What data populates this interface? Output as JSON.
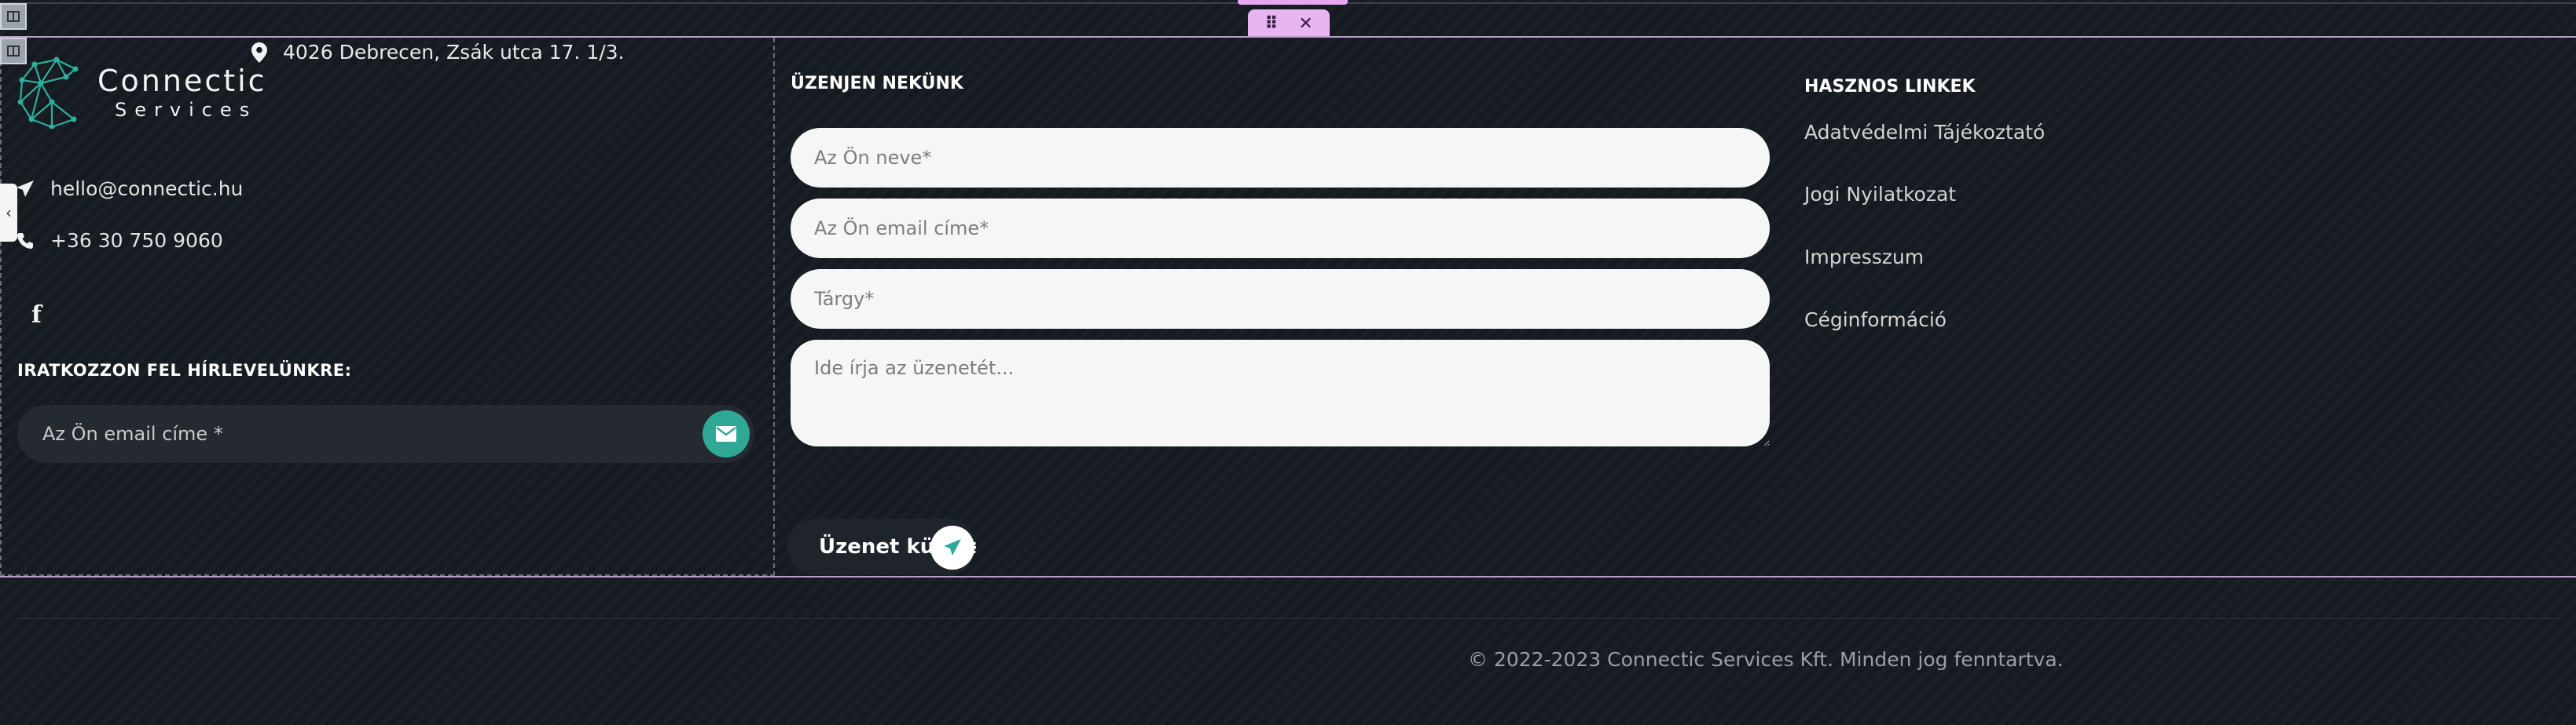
{
  "editor": {
    "handle_move": "⠿",
    "handle_close": "✕"
  },
  "contact": {
    "address": "4026 Debrecen, Zsák utca 17. 1/3.",
    "email": "hello@connectic.hu",
    "phone": "+36 30 750 9060"
  },
  "logo": {
    "name": "Connectic",
    "sub": "Services"
  },
  "newsletter": {
    "title": "IRATKOZZON FEL HÍRLEVELÜNKRE:",
    "placeholder": "Az Ön email címe *"
  },
  "form": {
    "title": "ÜZENJEN NEKÜNK",
    "name_placeholder": "Az Ön neve*",
    "email_placeholder": "Az Ön email címe*",
    "subject_placeholder": "Tárgy*",
    "message_placeholder": "Ide írja az üzenetét...",
    "send_label": "Üzenet küldése"
  },
  "links": {
    "title": "HASZNOS LINKEK",
    "items": [
      "Adatvédelmi Tájékoztató",
      "Jogi Nyilatkozat",
      "Impresszum",
      "Céginformáció"
    ]
  },
  "footer": {
    "copyright": "© 2022-2023 Connectic Services Kft. Minden jog fenntartva."
  },
  "colors": {
    "background": "#151a21",
    "accent": "#2fa896",
    "editor_pink": "#e9b4f2"
  }
}
